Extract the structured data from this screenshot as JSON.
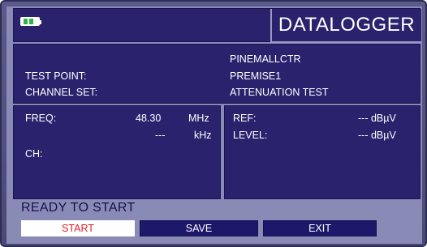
{
  "header": {
    "title": "DATALOGGER",
    "battery_icon": "battery-icon"
  },
  "info": {
    "point_value": "PINEMALLCTR",
    "test_point_label": "TEST POINT:",
    "test_point_value": "PREMISE1",
    "channel_set_label": "CHANNEL SET:",
    "channel_set_value": "ATTENUATION TEST"
  },
  "left_panel": {
    "freq_label": "FREQ:",
    "freq_value": "48.30",
    "freq_unit": "MHz",
    "offset_value": "---",
    "offset_unit": "kHz",
    "ch_label": "CH:"
  },
  "right_panel": {
    "ref_label": "REF:",
    "ref_value": "--- dBµV",
    "level_label": "LEVEL:",
    "level_value": "--- dBµV"
  },
  "status": "READY TO START",
  "buttons": {
    "start": "START",
    "save": "SAVE",
    "exit": "EXIT"
  },
  "colors": {
    "panel": "#2a226d",
    "screen": "#8a8ab6",
    "start_text": "#e0202a",
    "battery_cell": "#2fb24a"
  }
}
